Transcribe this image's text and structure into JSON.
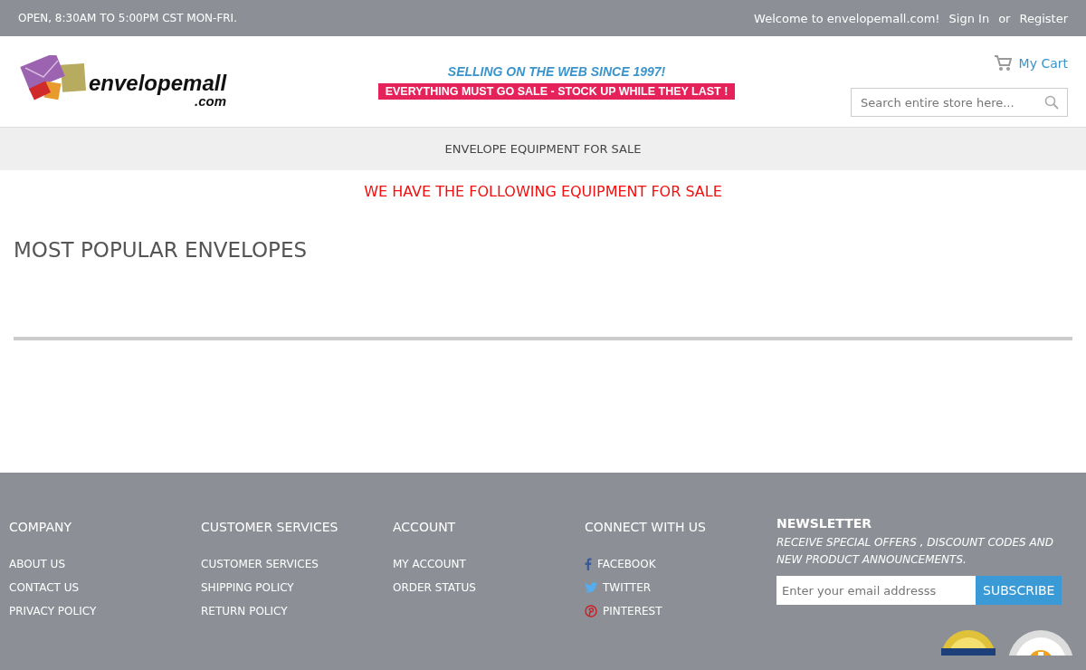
{
  "top_bar": {
    "hours": "OPEN, 8:30AM TO 5:00PM CST MON-FRI.",
    "welcome": "Welcome to envelopemall.com!",
    "sign_in": "Sign In",
    "or": "or",
    "register": "Register"
  },
  "header": {
    "logo": {
      "name": "envelopemall",
      "suffix": ".com"
    },
    "tagline": "SELLING ON THE WEB SINCE 1997!",
    "sale_banner": "EVERYTHING MUST GO SALE - STOCK UP WHILE THEY LAST !",
    "cart": "My Cart",
    "search": {
      "placeholder": "Search entire store here..."
    }
  },
  "nav": {
    "items": [
      "ENVELOPE EQUIPMENT FOR SALE"
    ]
  },
  "notice": "WE HAVE THE FOLLOWING EQUIPMENT FOR SALE",
  "section_title": "MOST POPULAR ENVELOPES",
  "footer": {
    "columns": [
      {
        "title": "COMPANY",
        "links": [
          {
            "label": "ABOUT US"
          },
          {
            "label": "CONTACT US"
          },
          {
            "label": "PRIVACY POLICY"
          }
        ]
      },
      {
        "title": "CUSTOMER SERVICES",
        "links": [
          {
            "label": "CUSTOMER SERVICES"
          },
          {
            "label": "SHIPPING POLICY"
          },
          {
            "label": "RETURN POLICY"
          }
        ]
      },
      {
        "title": "ACCOUNT",
        "links": [
          {
            "label": "MY ACCOUNT"
          },
          {
            "label": "ORDER STATUS"
          }
        ]
      },
      {
        "title": "CONNECT WITH US",
        "links": [
          {
            "label": "FACEBOOK",
            "kind": "facebook",
            "color": "#3b5998"
          },
          {
            "label": "TWITTER",
            "kind": "twitter",
            "color": "#55acee"
          },
          {
            "label": "PINTEREST",
            "kind": "pinterest",
            "color": "#cb2027"
          }
        ]
      }
    ],
    "newsletter": {
      "title": "NEWSLETTER",
      "text": "RECEIVE SPECIAL OFFERS , DISCOUNT CODES AND NEW PRODUCT ANNOUNCEMENTS.",
      "email": {
        "placeholder": "Enter your email addresss"
      },
      "button": "SUBSCRIBE"
    }
  }
}
